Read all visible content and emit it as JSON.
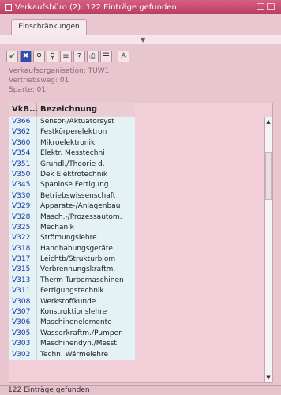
{
  "window": {
    "title": "Verkaufsbüro (2): 122 Einträge gefunden"
  },
  "tabs": [
    {
      "label": "Einschränkungen"
    }
  ],
  "toolbar": {
    "buttons": [
      {
        "icon": "check-icon",
        "glyph": "✔"
      },
      {
        "icon": "cancel-icon",
        "glyph": "✖"
      },
      {
        "icon": "find-icon",
        "glyph": "⚲"
      },
      {
        "icon": "find-next-icon",
        "glyph": "⚲"
      },
      {
        "icon": "sort-icon",
        "glyph": "≡"
      },
      {
        "icon": "help-icon",
        "glyph": "?"
      },
      {
        "icon": "print-icon",
        "glyph": "⎙"
      },
      {
        "icon": "list-icon",
        "glyph": "☰"
      },
      {
        "icon": "personalize-icon",
        "glyph": "♙"
      }
    ]
  },
  "info": {
    "line1": "Verkaufsorganisation: TUW1",
    "line2": "Vertriebsweg: 01",
    "line3": "Sparte: 01"
  },
  "table": {
    "headers": {
      "code": "VkB...",
      "desc": "Bezeichnung"
    },
    "rows": [
      {
        "code": "V366",
        "desc": "Sensor-/Aktuatorsyst"
      },
      {
        "code": "V362",
        "desc": "Festkörperelektron"
      },
      {
        "code": "V360",
        "desc": "Mikroelektronik"
      },
      {
        "code": "V354",
        "desc": "Elektr. Messtechni"
      },
      {
        "code": "V351",
        "desc": "Grundl./Theorie d."
      },
      {
        "code": "V350",
        "desc": "Dek Elektrotechnik"
      },
      {
        "code": "V345",
        "desc": "Spanlose Fertigung"
      },
      {
        "code": "V330",
        "desc": "Betriebswissenschaft"
      },
      {
        "code": "V329",
        "desc": "Apparate-/Anlagenbau"
      },
      {
        "code": "V328",
        "desc": "Masch.-/Prozessautom."
      },
      {
        "code": "V325",
        "desc": "Mechanik"
      },
      {
        "code": "V322",
        "desc": "Strömungslehre"
      },
      {
        "code": "V318",
        "desc": "Handhabungsgeräte"
      },
      {
        "code": "V317",
        "desc": "Leichtb/Strukturbiom"
      },
      {
        "code": "V315",
        "desc": "Verbrennungskraftm."
      },
      {
        "code": "V313",
        "desc": "Therm Turbomaschinen"
      },
      {
        "code": "V311",
        "desc": "Fertigungstechnik"
      },
      {
        "code": "V308",
        "desc": "Werkstoffkunde"
      },
      {
        "code": "V307",
        "desc": "Konstruktionslehre"
      },
      {
        "code": "V306",
        "desc": "Maschinenelemente"
      },
      {
        "code": "V305",
        "desc": "Wasserkraftm./Pumpen"
      },
      {
        "code": "V303",
        "desc": "Maschinendyn./Messt."
      },
      {
        "code": "V302",
        "desc": "Techn. Wärmelehre"
      }
    ]
  },
  "status": {
    "text": "122 Einträge gefunden"
  }
}
